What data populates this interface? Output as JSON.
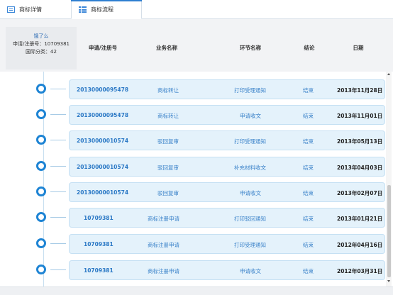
{
  "tabs": [
    {
      "label": "商标详情",
      "icon": "document-icon"
    },
    {
      "label": "商标流程",
      "icon": "list-icon"
    }
  ],
  "info": {
    "name": "饿了么",
    "reg_line": "申请/注册号：10709381",
    "class_line": "国际分类：42"
  },
  "columns": [
    "申请/注册号",
    "业务名称",
    "环节名称",
    "结论",
    "日期"
  ],
  "rows": [
    {
      "no": "20130000095478",
      "biz": "商标转让",
      "step": "打印受理通知",
      "result": "结束",
      "date": "2013年11月28日"
    },
    {
      "no": "20130000095478",
      "biz": "商标转让",
      "step": "申请收文",
      "result": "结束",
      "date": "2013年11月01日"
    },
    {
      "no": "20130000010574",
      "biz": "驳回复审",
      "step": "打印受理通知",
      "result": "结束",
      "date": "2013年05月13日"
    },
    {
      "no": "20130000010574",
      "biz": "驳回复审",
      "step": "补充材料收文",
      "result": "结束",
      "date": "2013年04月03日"
    },
    {
      "no": "20130000010574",
      "biz": "驳回复审",
      "step": "申请收文",
      "result": "结束",
      "date": "2013年02月07日"
    },
    {
      "no": "10709381",
      "biz": "商标注册申请",
      "step": "打印驳回通知",
      "result": "结束",
      "date": "2013年01月21日"
    },
    {
      "no": "10709381",
      "biz": "商标注册申请",
      "step": "打印受理通知",
      "result": "结束",
      "date": "2012年04月16日"
    },
    {
      "no": "10709381",
      "biz": "商标注册申请",
      "step": "申请收文",
      "result": "结束",
      "date": "2012年03月31日"
    }
  ],
  "colors": {
    "accent": "#1e84d4",
    "card_bg": "#e4f2fb",
    "link": "#2a78c5"
  }
}
